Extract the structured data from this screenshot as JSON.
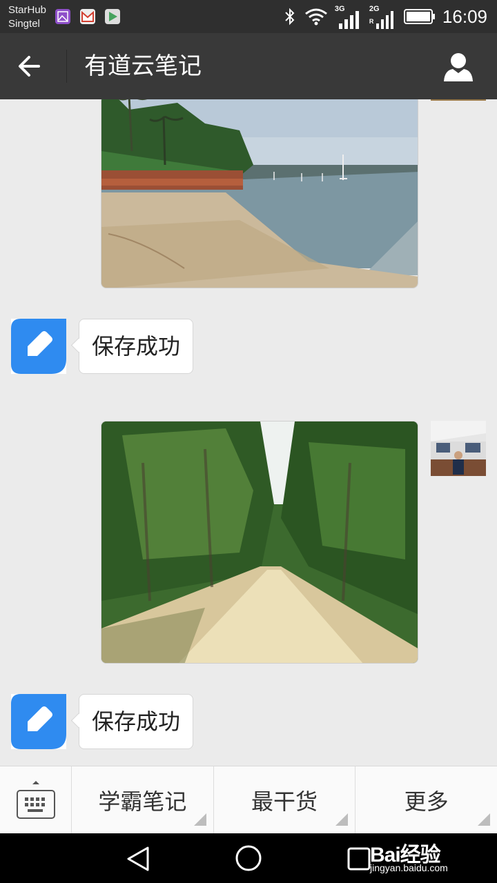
{
  "status_bar": {
    "carrier_1": "StarHub",
    "carrier_2": "Singtel",
    "network_3g": "3G",
    "network_2g": "2G",
    "time": "16:09"
  },
  "app_bar": {
    "title": "有道云笔记"
  },
  "messages": [
    {
      "type": "photo",
      "sender": "self",
      "scene": "beach"
    },
    {
      "type": "text",
      "sender": "bot",
      "text": "保存成功"
    },
    {
      "type": "photo",
      "sender": "self",
      "scene": "forest-path"
    },
    {
      "type": "text",
      "sender": "bot",
      "text": "保存成功"
    }
  ],
  "bottom_menu": {
    "items": [
      {
        "label": "学霸笔记"
      },
      {
        "label": "最干货"
      },
      {
        "label": "更多"
      }
    ]
  },
  "watermark": {
    "brand": "Bai经验",
    "url": "jingyan.baidu.com"
  },
  "colors": {
    "status_bar": "#2f2f2f",
    "app_bar": "#393939",
    "chat_background": "#ebebeb",
    "bot_icon_blue": "#2f8bf0"
  }
}
